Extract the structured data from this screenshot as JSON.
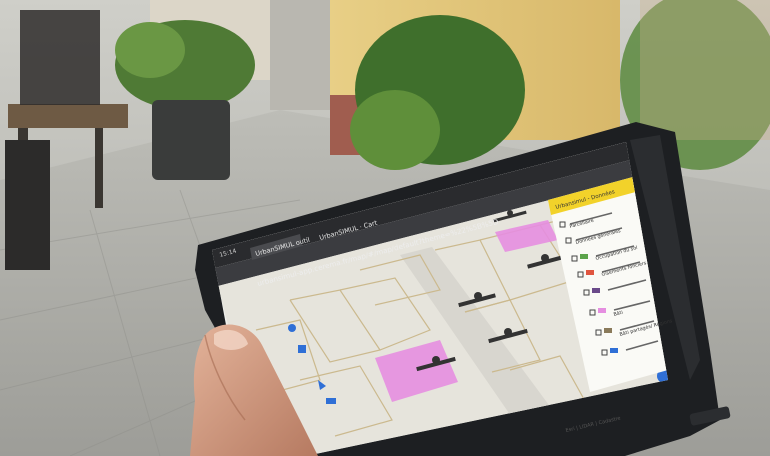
{
  "browser": {
    "status_time": "15:14",
    "tab_1": "UrbanSIMUL outil",
    "tab_2": "UrbanSIMUL · Cart",
    "url": "urbansimul-app.cerema.fr/map/#/map/default?theme=%22%5B%5D"
  },
  "panel": {
    "header": "Urbansimul - Données",
    "items": [
      "Parcellaire",
      "Données générales",
      "Occupation du sol",
      "Gisements fonciers",
      "Bâti",
      "Bâti partagés/ Régions"
    ]
  },
  "footer": {
    "attribution": "Esri | LIDAR | Cadastre"
  },
  "colors": {
    "parcel_pink": "#e58ee0",
    "panel_yellow": "#f2d22a",
    "tablet_case": "#1d1f22",
    "street": "#d8d6cf"
  }
}
